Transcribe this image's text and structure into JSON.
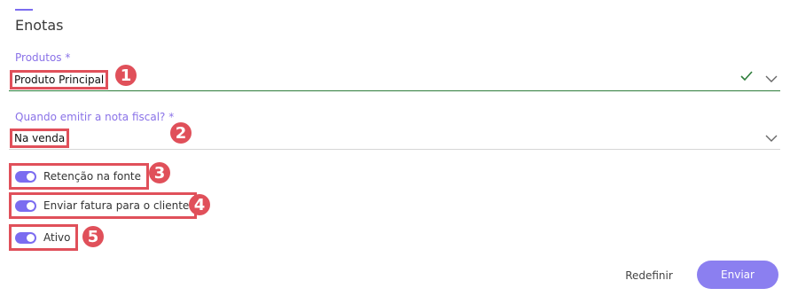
{
  "section": {
    "title": "Enotas"
  },
  "produtos": {
    "label": "Produtos *",
    "value": "Produto Principal",
    "status_color": "#2e7d3b"
  },
  "emitir": {
    "label": "Quando emitir a nota fiscal? *",
    "value": "Na venda"
  },
  "toggles": [
    {
      "label": "Retenção na fonte",
      "checked": true
    },
    {
      "label": "Enviar fatura para o cliente",
      "checked": true
    },
    {
      "label": "Ativo",
      "checked": true
    }
  ],
  "badges": [
    "1",
    "2",
    "3",
    "4",
    "5"
  ],
  "buttons": {
    "reset": "Redefinir",
    "submit": "Enviar"
  },
  "colors": {
    "accent": "#7b6cf0",
    "annotation": "#e0505a",
    "submit": "#8b7ff0"
  }
}
